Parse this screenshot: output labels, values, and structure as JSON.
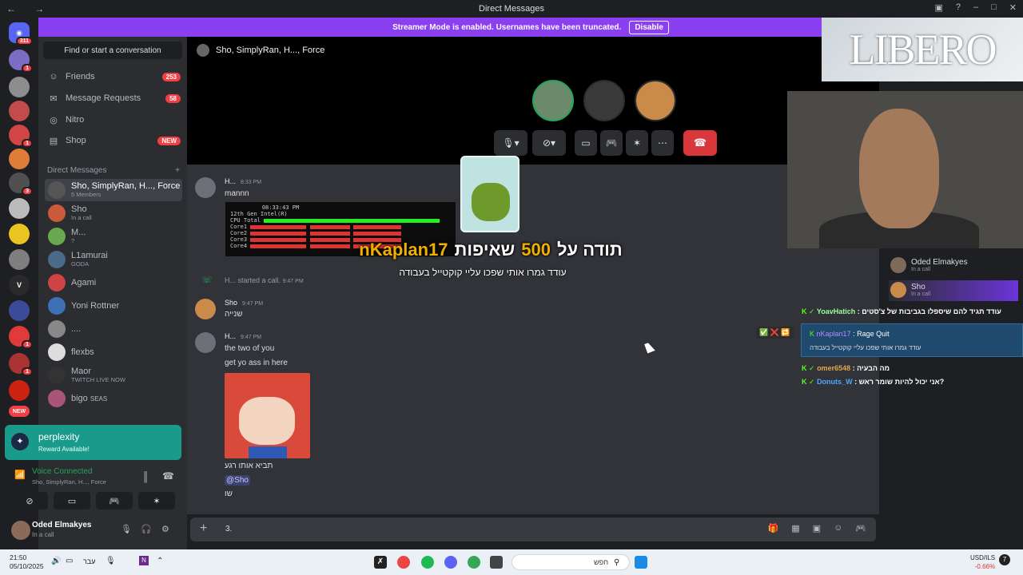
{
  "window": {
    "title": "Direct Messages"
  },
  "banner": {
    "text": "Streamer Mode is enabled. Usernames have been truncated.",
    "button": "Disable"
  },
  "rail": {
    "badges": [
      "311",
      "1",
      "1",
      "3",
      "1",
      "1",
      "125",
      "NEW"
    ]
  },
  "sidebar": {
    "search_placeholder": "Find or start a conversation",
    "nav": [
      {
        "label": "Friends",
        "count": "253",
        "icon": "friends-icon"
      },
      {
        "label": "Message Requests",
        "count": "58",
        "icon": "mail-icon"
      },
      {
        "label": "Nitro",
        "count": "",
        "icon": "nitro-icon"
      },
      {
        "label": "Shop",
        "count": "NEW",
        "icon": "shop-icon"
      }
    ],
    "dm_header": "Direct Messages",
    "dms": [
      {
        "name": "Sho, SimplyRan, H..., Force",
        "sub": "5 Members"
      },
      {
        "name": "Sho",
        "sub": "In a call"
      },
      {
        "name": "M...",
        "sub": "?"
      },
      {
        "name": "L1amurai",
        "sub": "GODA"
      },
      {
        "name": "Agami",
        "sub": ""
      },
      {
        "name": "Yoni Rottner",
        "sub": ""
      },
      {
        "name": "....",
        "sub": ""
      },
      {
        "name": "flexbs",
        "sub": ""
      },
      {
        "name": "Maor",
        "sub": "TWITCH LIVE NOW"
      },
      {
        "name": "bigo",
        "sub": "SEAS"
      }
    ],
    "promo": {
      "title": "perplexity",
      "sub": "Reward Available!"
    },
    "voice": {
      "status": "Voice Connected",
      "channel": "Sho, SimplyRan, H..., Force"
    },
    "user": {
      "name": "Oded Elmakyes",
      "status": "In a call"
    }
  },
  "chat": {
    "header": "Sho, SimplyRan, H..., Force",
    "messages": {
      "m1": {
        "author": "H...",
        "time": "8:33 PM",
        "text": "mannn"
      },
      "cpu": {
        "time": "08:33:43 PM",
        "model": "12th Gen Intel(R)",
        "total": "CPU Total"
      },
      "call": {
        "author": "H...",
        "text": "started a call.",
        "time": "9:47 PM"
      },
      "m2": {
        "author": "Sho",
        "time": "9:47 PM",
        "text": "שנייה"
      },
      "m3": {
        "author": "H...",
        "time": "9:47 PM",
        "lines": [
          "the two of you",
          "get yo ass in here"
        ]
      },
      "m3b": {
        "lines": [
          "תביא אותו רגע",
          "@Sho",
          "שו"
        ]
      }
    },
    "input_value": "3."
  },
  "overlay": {
    "title_white": "תודה על",
    "title_amount": "500",
    "title_white2": "שאיפות",
    "donor": "nKaplan17",
    "sub": "עודד גמרו אותי שפכו עליי קוקטייל בעבודה"
  },
  "stream": {
    "logo": "LIBERO",
    "voice_users": [
      {
        "name": "Oded Elmakyes",
        "status": "In a call"
      },
      {
        "name": "Sho",
        "status": "In a call"
      }
    ],
    "chat": [
      {
        "user": "YoavHatich",
        "text": "עודד תגיד להם שיספלו בגביבות של צ'סטים"
      },
      {
        "user": "omer6548",
        "text": "מה הבעיה"
      },
      {
        "user": "Donuts_W",
        "text": "אני יכול להיות שומר ראש?"
      }
    ],
    "rage": {
      "user": "nKaplan17",
      "title": "Rage Quit",
      "text": "עודד גמרו אותי שפכו עליי קוקטייל בעבודה"
    }
  },
  "taskbar": {
    "time": "21:50",
    "date": "05/10/2025",
    "lang": "עבר",
    "search": "חפש",
    "fx_pair": "USD/ILS",
    "fx_change": "-0.66%"
  },
  "colors": {
    "accent": "#5865f2",
    "banner": "#8a3ff0",
    "danger": "#da373c",
    "online": "#23a55a"
  }
}
